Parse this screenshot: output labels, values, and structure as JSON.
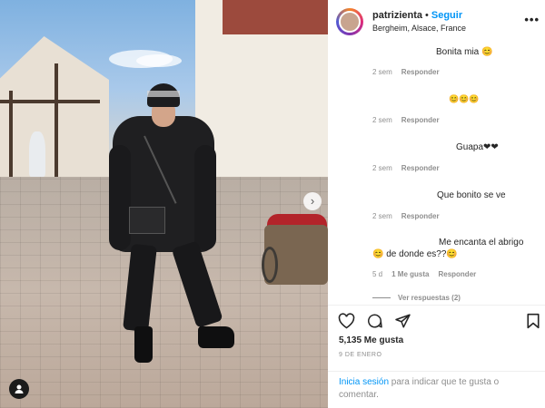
{
  "post": {
    "username": "patrizienta",
    "separator": "•",
    "follow_label": "Seguir",
    "location": "Bergheim, Alsace, France",
    "more_label": "•••"
  },
  "comments": [
    {
      "text": "Bonita mia 😊",
      "time": "2 sem",
      "reply": "Responder"
    },
    {
      "text": "😊😊😊",
      "time": "2 sem",
      "reply": "Responder"
    },
    {
      "text": "Guapa❤❤",
      "time": "2 sem",
      "reply": "Responder"
    },
    {
      "text": "Que bonito se ve",
      "time": "2 sem",
      "reply": "Responder"
    },
    {
      "text_line1": "Me encanta el abrigo",
      "text_line2": "😊 de donde es??😊",
      "time": "5 d",
      "likes": "1 Me gusta",
      "reply": "Responder"
    }
  ],
  "view_replies": "Ver respuestas (2)",
  "actions": {
    "likes": "5,135 Me gusta",
    "date": "9 DE ENERO"
  },
  "login": {
    "link": "Inicia sesión",
    "rest": " para indicar que te gusta o comentar."
  },
  "icons": {
    "like": "heart-icon",
    "comment": "comment-icon",
    "share": "share-icon",
    "save": "bookmark-icon",
    "next": "chevron-right-icon",
    "tag": "user-tag-icon"
  }
}
